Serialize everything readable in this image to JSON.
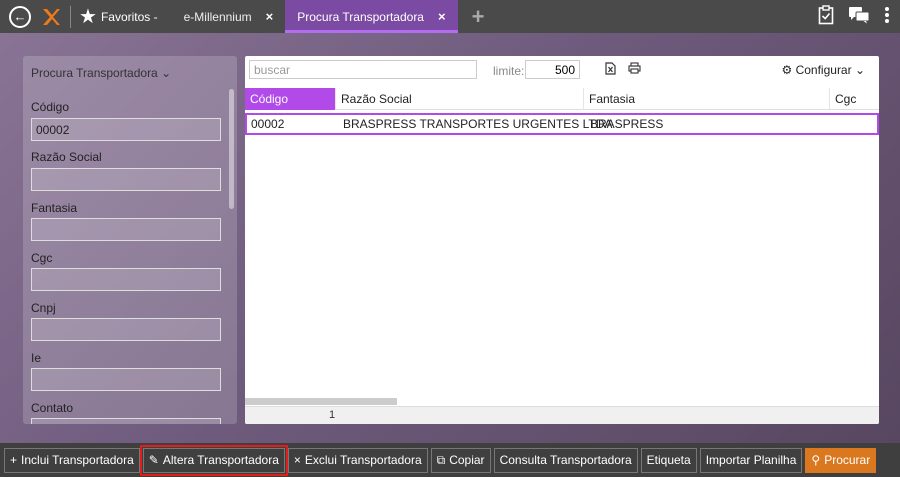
{
  "topbar": {
    "favorites_label": "Favoritos -",
    "tabs": [
      {
        "label": "e-Millennium",
        "close": "×"
      },
      {
        "label": "Procura Transportadora",
        "close": "×"
      }
    ],
    "add_tab": "+"
  },
  "sidebar": {
    "title": "Procura Transportadora ⌄",
    "fields": [
      {
        "label": "Código",
        "value": "00002"
      },
      {
        "label": "Razão Social",
        "value": ""
      },
      {
        "label": "Fantasia",
        "value": ""
      },
      {
        "label": "Cgc",
        "value": ""
      },
      {
        "label": "Cnpj",
        "value": ""
      },
      {
        "label": "Ie",
        "value": ""
      },
      {
        "label": "Contato",
        "value": ""
      }
    ]
  },
  "search": {
    "placeholder": "buscar",
    "limit_label": "limite:",
    "limit_value": "500",
    "configure_label": "Configurar ⌄"
  },
  "grid": {
    "columns": [
      "Código",
      "Razão Social",
      "Fantasia",
      "Cgc"
    ],
    "rows": [
      {
        "codigo": "00002",
        "razao_social": "BRASPRESS TRANSPORTES URGENTES LTDA",
        "fantasia": "BRASPRESS",
        "cgc": ""
      }
    ],
    "page": "1"
  },
  "toolbar": {
    "buttons": [
      {
        "icon": "+",
        "label": "Inclui Transportadora"
      },
      {
        "icon": "✎",
        "label": "Altera Transportadora"
      },
      {
        "icon": "×",
        "label": "Exclui Transportadora"
      },
      {
        "icon": "⧉",
        "label": "Copiar"
      },
      {
        "icon": "",
        "label": "Consulta Transportadora"
      },
      {
        "icon": "",
        "label": "Etiqueta"
      },
      {
        "icon": "",
        "label": "Importar Planilha"
      },
      {
        "icon": "⚲",
        "label": "Procurar"
      }
    ]
  },
  "colors": {
    "accent": "#b14ae8",
    "active_tab": "#7b4aa3",
    "primary_button": "#d9781f",
    "highlight": "#e01e1e"
  }
}
